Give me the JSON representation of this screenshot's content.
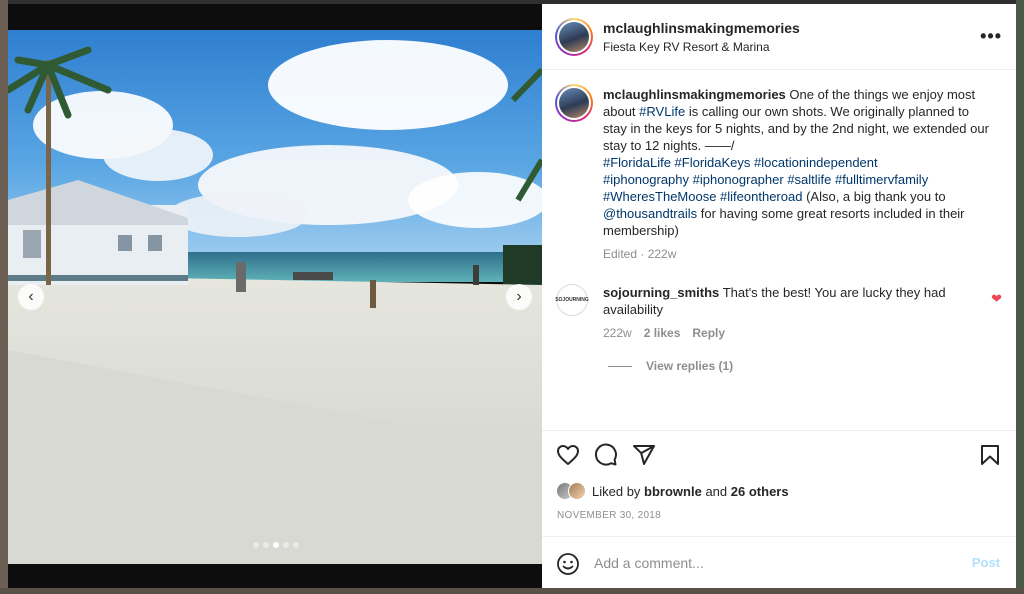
{
  "post": {
    "username": "mclaughlinsmakingmemories",
    "location": "Fiesta Key RV Resort & Marina",
    "caption": {
      "username": "mclaughlinsmakingmemories",
      "text_1": "One of the things we enjoy most about",
      "tag_rvlife": "#RVLife",
      "text_2": "is calling our own shots. We originally planned to stay in the keys for 5 nights, and by the 2nd night, we extended our stay to 12 nights. ——/",
      "hashtags_1": "#FloridaLife #FloridaKeys #locationindependent",
      "hashtags_2": "#iphonography #iphonographer #saltlife #fulltimervfamily",
      "hashtags_3": "#WheresTheMoose #lifeontheroad",
      "text_3": "(Also, a big thank you to",
      "mention": "@thousandtrails",
      "text_4": "for having some great resorts included in their membership)"
    },
    "meta": "Edited · 222w"
  },
  "comment": {
    "avatar_text": "SOJOURNING",
    "username": "sojourning_smiths",
    "text": "That's the best! You are lucky they had availability",
    "time": "222w",
    "likes": "2 likes",
    "reply_label": "Reply",
    "view_replies": "View replies (1)"
  },
  "likes": {
    "prefix": "Liked by",
    "user": "bbrownle",
    "middle": "and",
    "others": "26 others"
  },
  "date": "NOVEMBER 30, 2018",
  "add_comment": {
    "placeholder": "Add a comment...",
    "post_label": "Post"
  },
  "colors": {
    "link": "#00376b",
    "like_red": "#ed4956",
    "post_disabled": "#b2dffc"
  },
  "icons": [
    "heart-icon",
    "comment-icon",
    "share-icon",
    "bookmark-icon",
    "emoji-icon",
    "more-icon"
  ]
}
